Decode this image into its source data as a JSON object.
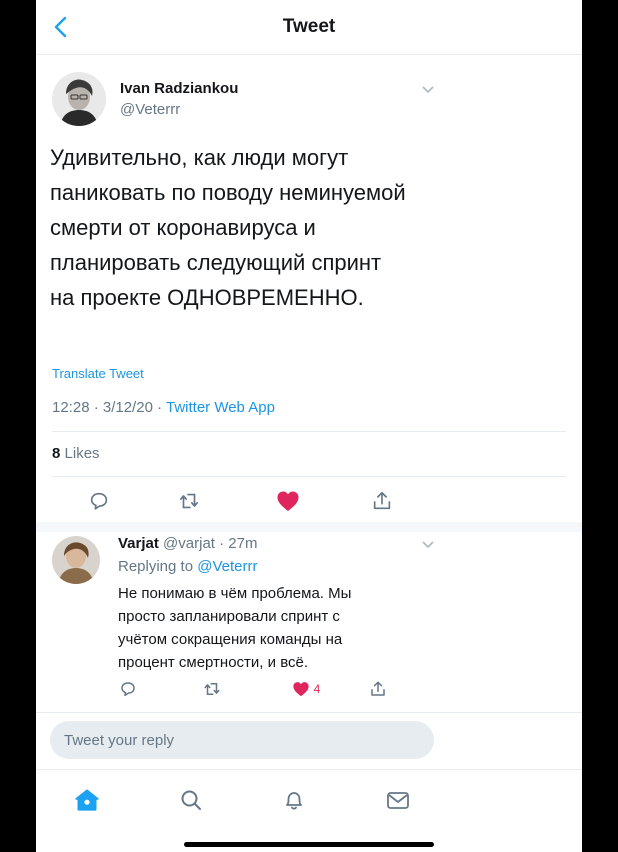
{
  "header": {
    "title": "Tweet",
    "back_icon": "chevron-left-icon"
  },
  "tweet": {
    "author_name": "Ivan Radziankou",
    "author_handle": "@Veterrr",
    "lines": [
      "Удивительно, как люди могут",
      "паниковать по поводу неминуемой",
      "смерти от коронавируса и",
      "планировать следующий спринт",
      "на проекте ОДНОВРЕМЕННО."
    ],
    "translate_label": "Translate Tweet",
    "time_date": "12:28 · 3/12/20 ·",
    "app": "Twitter Web App",
    "likes_count": "8",
    "likes_label": "Likes",
    "actions": [
      "reply-icon",
      "retweet-icon",
      "like-icon",
      "share-icon"
    ]
  },
  "reply": {
    "name": "Varjat",
    "handle_time": "@varjat · 27m",
    "replying_prefix": "Replying to",
    "replying_to": "@Veterrr",
    "lines": [
      "Не понимаю в чём проблема. Мы",
      "просто запланировали спринт с",
      "учётом сокращения команды на",
      "процент смертности, и всё."
    ],
    "like_count": "4"
  },
  "composer": {
    "placeholder": "Tweet your reply"
  },
  "tabbar": {
    "items": [
      "home-icon",
      "search-icon",
      "notifications-icon",
      "messages-icon"
    ]
  },
  "colors": {
    "accent": "#1b95e0",
    "like": "#e0245e",
    "secondary_text": "#657786",
    "divider": "#e6ecf0"
  }
}
